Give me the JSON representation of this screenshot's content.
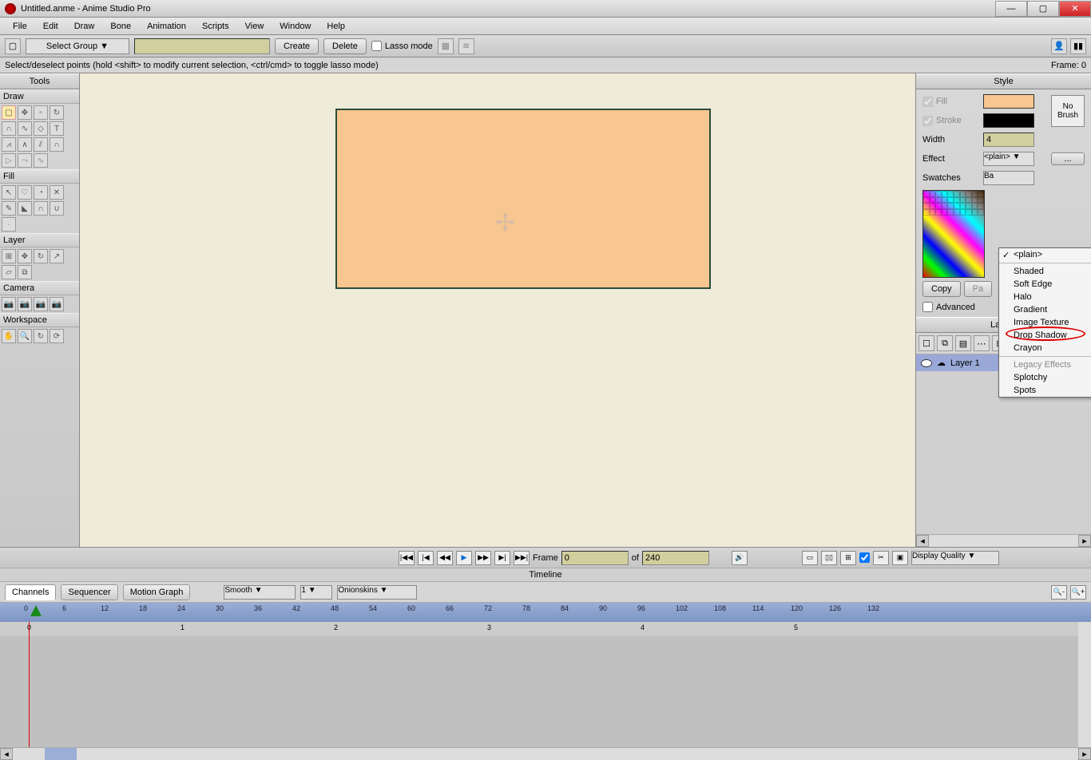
{
  "title": "Untitled.anme - Anime Studio Pro",
  "menus": [
    "File",
    "Edit",
    "Draw",
    "Bone",
    "Animation",
    "Scripts",
    "View",
    "Window",
    "Help"
  ],
  "optbar": {
    "select_group": "Select Group    ▼",
    "create": "Create",
    "delete": "Delete",
    "lasso": "Lasso mode"
  },
  "hint": "Select/deselect points (hold <shift> to modify current selection, <ctrl/cmd> to toggle lasso mode)",
  "frame_label": "Frame: 0",
  "tools": {
    "title": "Tools",
    "sections": {
      "draw": "Draw",
      "fill": "Fill",
      "layer": "Layer",
      "camera": "Camera",
      "workspace": "Workspace"
    }
  },
  "style": {
    "title": "Style",
    "fill": "Fill",
    "stroke": "Stroke",
    "width": "Width",
    "width_val": "4",
    "effect": "Effect",
    "effect_val": "<plain>  ▼",
    "dots": "...",
    "nobrush": "No Brush",
    "swatches": "Swatches",
    "basic": "Ba",
    "copy": "Copy",
    "paste": "Pa",
    "advanced": "Advanced"
  },
  "effect_menu": {
    "plain": "<plain>",
    "items": [
      "Shaded",
      "Soft Edge",
      "Halo",
      "Gradient",
      "Image Texture",
      "Drop Shadow",
      "Crayon"
    ],
    "legacy_hdr": "Legacy Effects",
    "legacy": [
      "Splotchy",
      "Spots"
    ]
  },
  "layers": {
    "title": "Layers",
    "layer1": "Layer 1"
  },
  "timeline": {
    "frame_lbl": "Frame",
    "of": "of",
    "cur": "0",
    "end": "240",
    "display_quality": "Display Quality   ▼",
    "title": "Timeline",
    "tabs": [
      "Channels",
      "Sequencer",
      "Motion Graph"
    ],
    "smooth": "Smooth        ▼",
    "one": "1  ▼",
    "onion": "Onionskins       ▼",
    "ticks": [
      0,
      6,
      12,
      18,
      24,
      30,
      36,
      42,
      48,
      54,
      60,
      66,
      72,
      78,
      84,
      90,
      96,
      102,
      108,
      114,
      120,
      126,
      132
    ],
    "seconds": [
      0,
      1,
      2,
      3,
      4,
      5
    ]
  }
}
